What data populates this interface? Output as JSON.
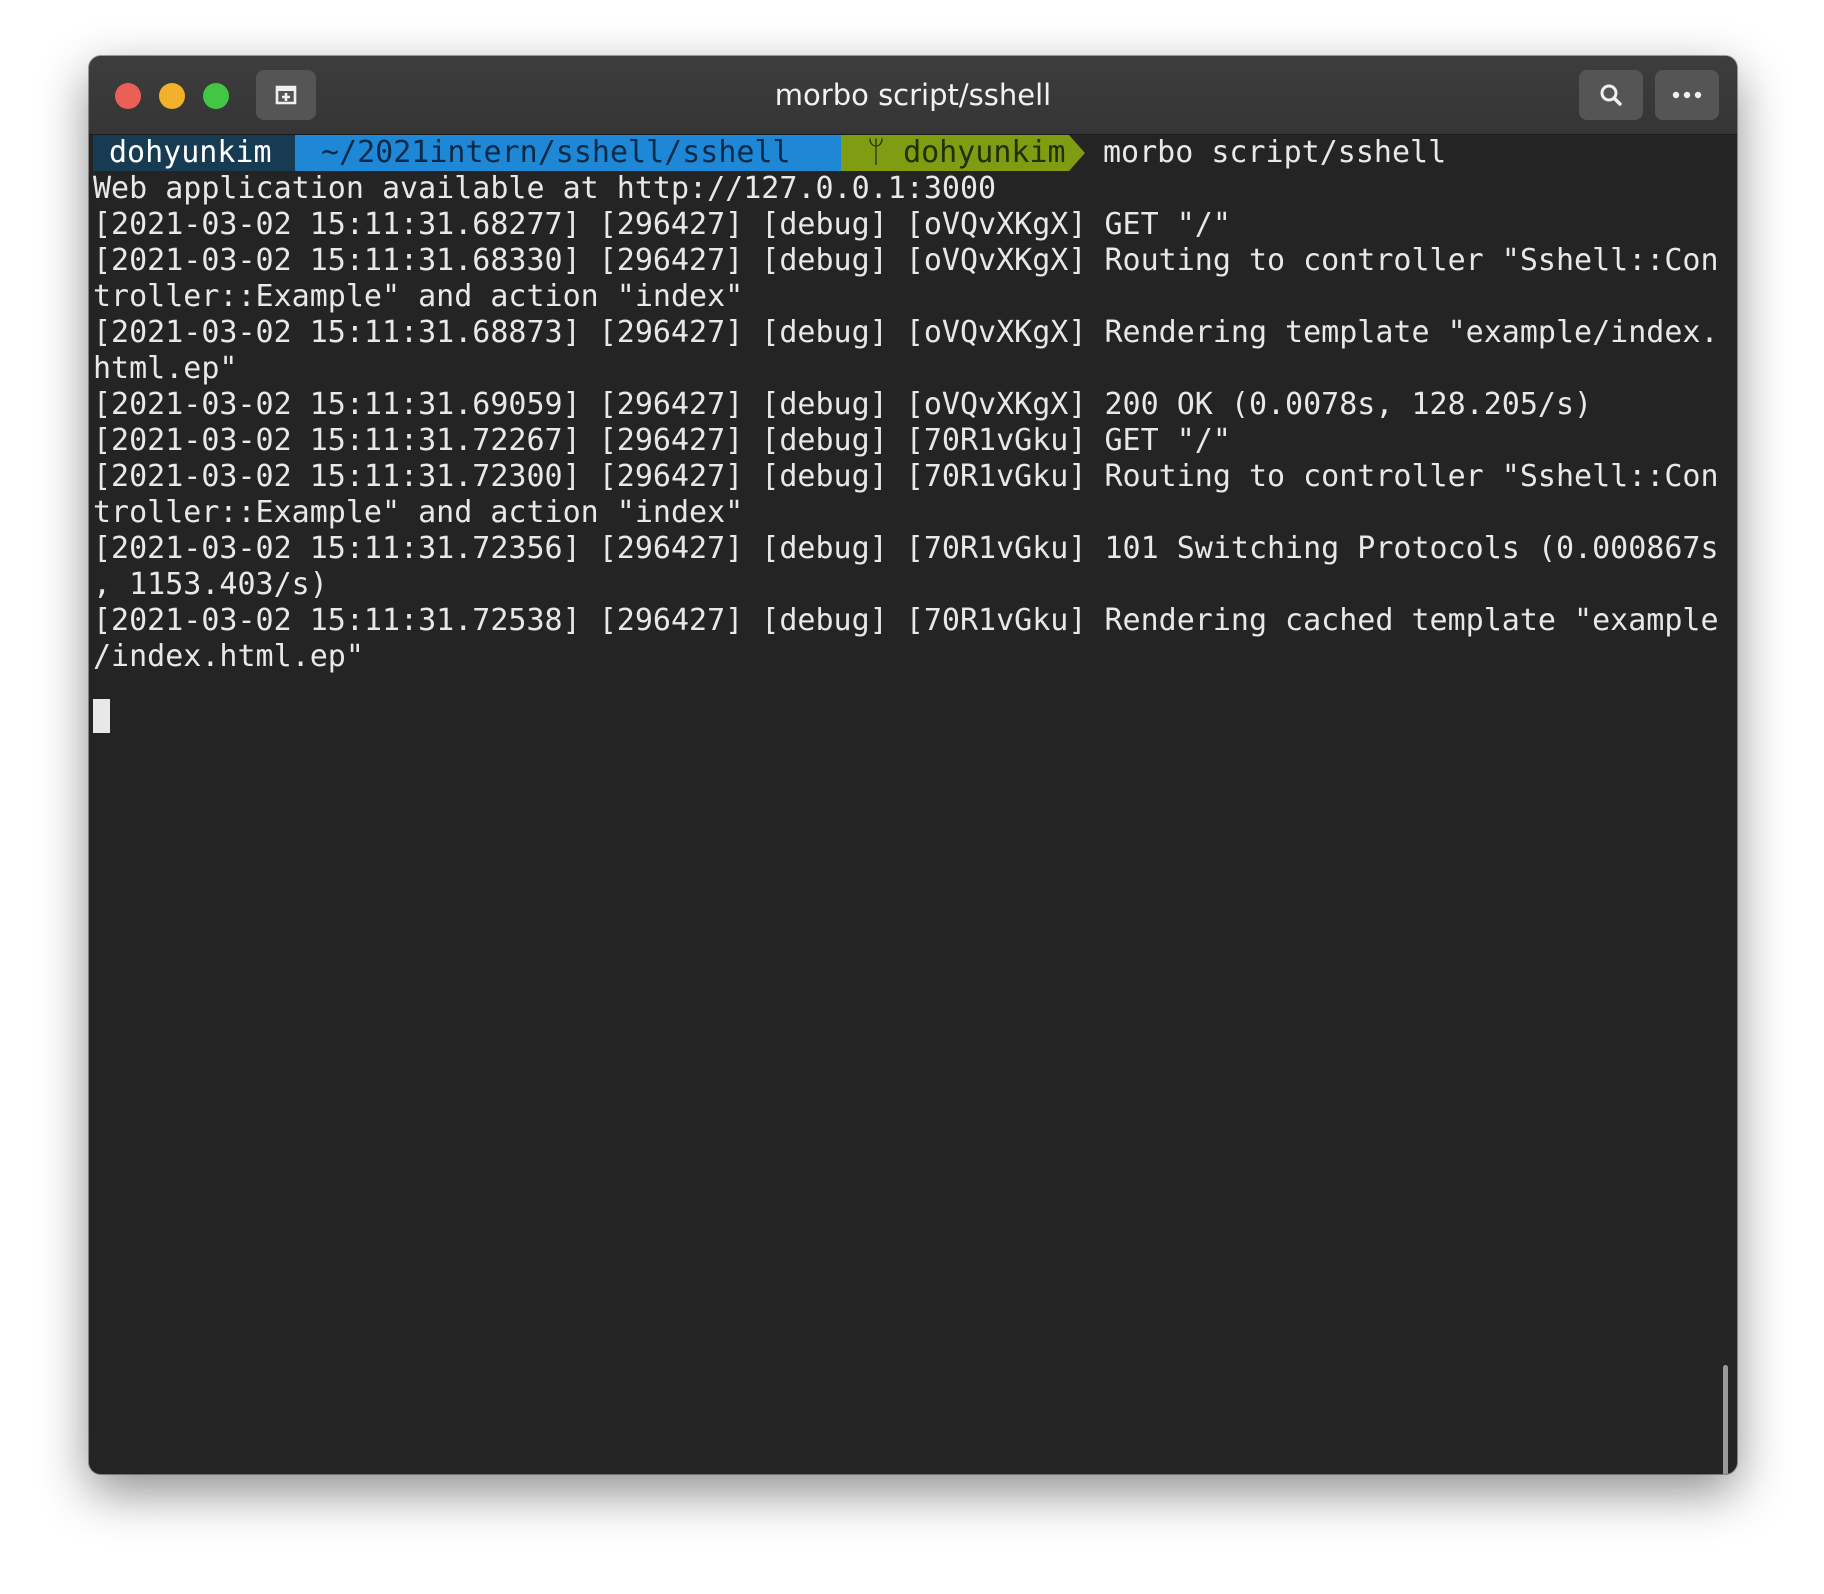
{
  "window": {
    "title": "morbo script/sshell",
    "colors": {
      "close": "#ec5f58",
      "minimize": "#f2b12a",
      "maximize": "#43c645",
      "terminal_bg": "#242424",
      "titlebar_bg": "#3a3a3a",
      "segment_user": "#173b52",
      "segment_path": "#1e88d6",
      "segment_git": "#7f9c12"
    },
    "icons": {
      "close": "close-icon",
      "minimize": "minimize-icon",
      "maximize": "maximize-icon",
      "new_tab": "new-tab-icon",
      "search": "search-icon",
      "menu": "more-icon"
    }
  },
  "prompt": {
    "user": "dohyunkim",
    "path": "~/2021intern/sshell/sshell",
    "branch_icon": "ᛘ",
    "branch": "dohyunkim",
    "command": "morbo script/sshell"
  },
  "output": [
    "Web application available at http://127.0.0.1:3000",
    "[2021-03-02 15:11:31.68277] [296427] [debug] [oVQvXKgX] GET \"/\"",
    "[2021-03-02 15:11:31.68330] [296427] [debug] [oVQvXKgX] Routing to controller \"Sshell::Con",
    "troller::Example\" and action \"index\"",
    "[2021-03-02 15:11:31.68873] [296427] [debug] [oVQvXKgX] Rendering template \"example/index.",
    "html.ep\"",
    "[2021-03-02 15:11:31.69059] [296427] [debug] [oVQvXKgX] 200 OK (0.0078s, 128.205/s)",
    "[2021-03-02 15:11:31.72267] [296427] [debug] [70R1vGku] GET \"/\"",
    "[2021-03-02 15:11:31.72300] [296427] [debug] [70R1vGku] Routing to controller \"Sshell::Con",
    "troller::Example\" and action \"index\"",
    "[2021-03-02 15:11:31.72356] [296427] [debug] [70R1vGku] 101 Switching Protocols (0.000867s",
    ", 1153.403/s)",
    "[2021-03-02 15:11:31.72538] [296427] [debug] [70R1vGku] Rendering cached template \"example",
    "/index.html.ep\""
  ]
}
